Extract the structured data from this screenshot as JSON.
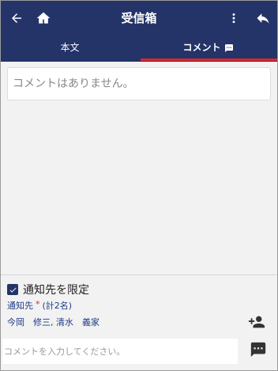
{
  "header": {
    "title": "受信箱",
    "back_icon": "arrow-left-icon",
    "home_icon": "home-icon",
    "menu_icon": "more-vert-icon",
    "reply_icon": "reply-icon"
  },
  "tabs": [
    {
      "label": "本文",
      "active": false
    },
    {
      "label": "コメント",
      "active": true,
      "icon": "comment-icon"
    }
  ],
  "comments": {
    "empty_message": "コメントはありません。"
  },
  "notify": {
    "limit_label": "通知先を限定",
    "limit_checked": true,
    "label": "通知先",
    "required_mark": "*",
    "count_text": "(計2名)",
    "recipients": "今岡　修三, 清水　義家"
  },
  "composer": {
    "placeholder": "コメントを入力してください。",
    "value": ""
  },
  "colors": {
    "primary": "#243468",
    "accent": "#e0262b",
    "link": "#1f3b8a"
  }
}
